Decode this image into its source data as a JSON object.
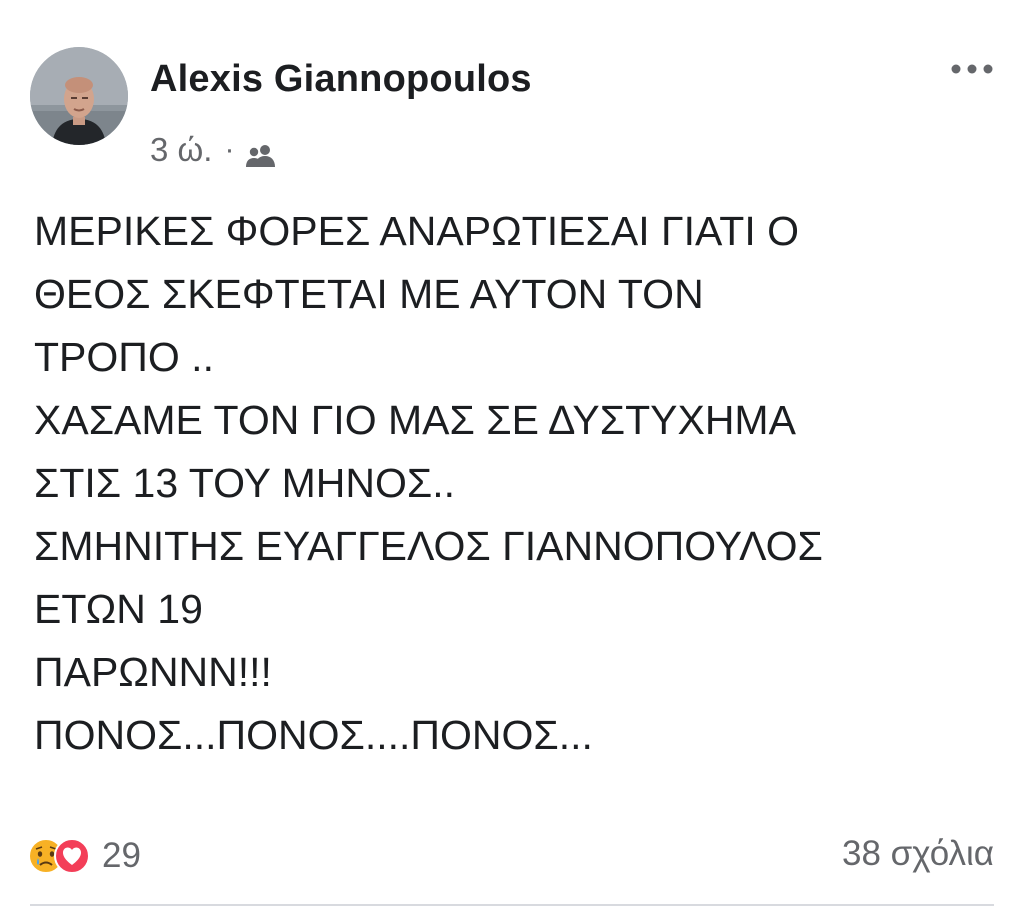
{
  "post": {
    "author": "Alexis Giannopoulos",
    "time": "3 ώ.",
    "separator": "·",
    "audience_icon": "friends-icon",
    "more_icon": "more-options-icon",
    "body_lines": [
      "ΜΕΡΙΚΕΣ ΦΟΡΕΣ ΑΝΑΡΩΤΙΕΣΑΙ ΓΙΑΤΙ Ο",
      "ΘΕΟΣ ΣΚΕΦΤΕΤΑΙ ΜΕ ΑΥΤΟΝ ΤΟΝ",
      "ΤΡΟΠΟ ..",
      "ΧΑΣΑΜΕ ΤΟΝ ΓΙΟ ΜΑΣ ΣΕ ΔΥΣΤΥΧΗΜΑ",
      "ΣΤΙΣ 13 ΤΟΥ ΜΗΝΟΣ..",
      "ΣΜΗΝΙΤΗΣ ΕΥΑΓΓΕΛΟΣ ΓΙΑΝΝΟΠΟΥΛΟΣ",
      "ΕΤΩΝ 19",
      "ΠΑΡΩΝΝΝ!!!",
      "ΠΟΝΟΣ...ΠΟΝΟΣ....ΠΟΝΟΣ..."
    ],
    "reactions": {
      "icons": [
        "sad-icon",
        "love-icon"
      ],
      "count": "29"
    },
    "comments": "38 σχόλια"
  },
  "colors": {
    "text": "#1c1e21",
    "secondary": "#65676b",
    "love": "#f33e58",
    "sad": "#f7b125",
    "divider": "#d8dadf"
  }
}
